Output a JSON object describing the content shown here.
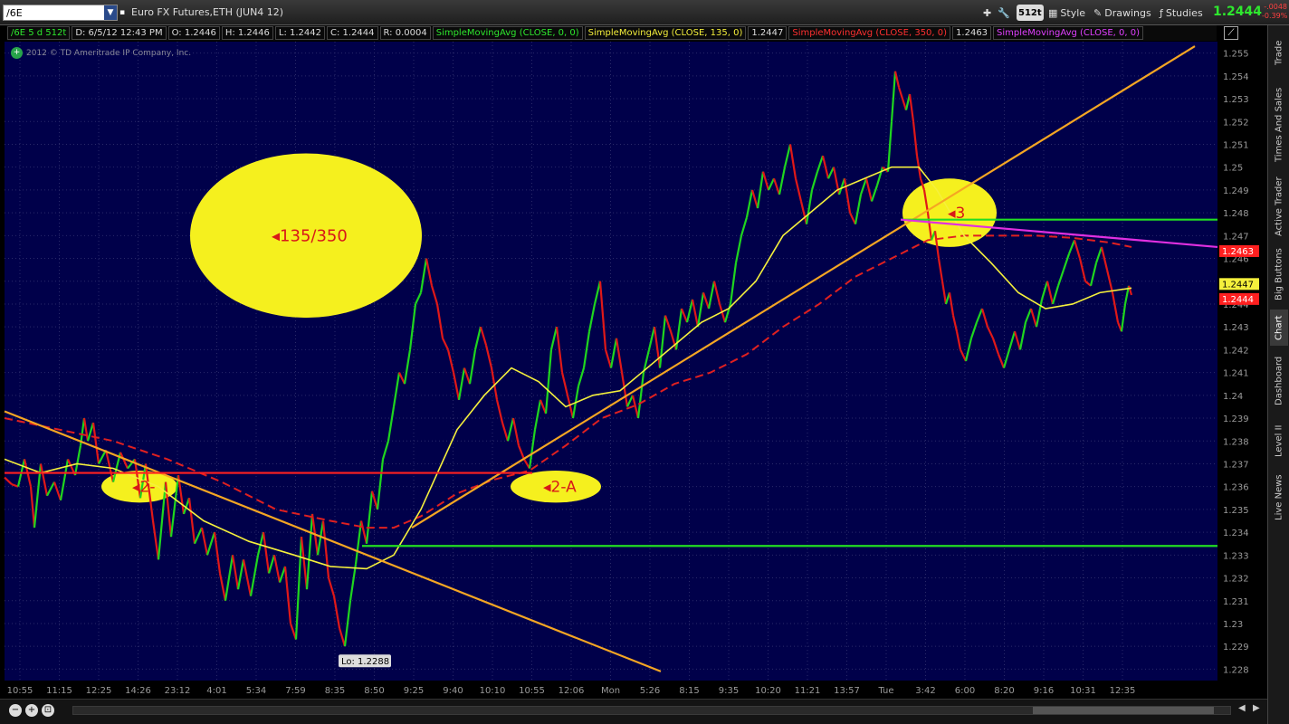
{
  "toolbar": {
    "symbol": "/6E",
    "title": "Euro FX Futures,ETH (JUN4 12)",
    "aggregation": "512t",
    "style_label": "Style",
    "drawings_label": "Drawings",
    "studies_label": "Studies",
    "last_price": "1.2444",
    "change_abs": "-.0048",
    "change_pct": "-0.39%"
  },
  "study_bar": {
    "symbol_cell": "/6E 5 d 512t",
    "date_cell": "D: 6/5/12 12:43 PM",
    "open_cell": "O: 1.2446",
    "high_cell": "H: 1.2446",
    "low_cell": "L: 1.2442",
    "close_cell": "C: 1.2444",
    "range_cell": "R: 0.0004",
    "sma1": "SimpleMovingAvg (CLOSE, 0, 0)",
    "sma2": "SimpleMovingAvg (CLOSE, 135, 0)",
    "sma2_val": "1.2447",
    "sma3": "SimpleMovingAvg (CLOSE, 350, 0)",
    "sma3_val": "1.2463",
    "sma4": "SimpleMovingAvg (CLOSE, 0, 0)"
  },
  "copyright": "2012 © TD Ameritrade IP Company, Inc.",
  "colors": {
    "background": "#00004a",
    "grid": "#2a2a6a",
    "up_bar": "#1fd61f",
    "down_bar": "#e01818",
    "sma_fast": "#f5f03c",
    "sma_slow": "#e02020",
    "trendline": "#f5a623",
    "support": "#22dd22",
    "resistance": "#ff2020",
    "channel": "#e030e0",
    "annotation_fill": "#f5f01e"
  },
  "right_tabs": [
    "Trade",
    "Times And Sales",
    "Active Trader",
    "Big Buttons",
    "Chart",
    "Dashboard",
    "Level II",
    "Live News"
  ],
  "chart_data": {
    "type": "line",
    "title": "",
    "xlabel": "",
    "ylabel": "",
    "ylim": [
      1.2275,
      1.2555
    ],
    "grid": true,
    "y_ticks": [
      "1.255",
      "1.254",
      "1.253",
      "1.252",
      "1.251",
      "1.25",
      "1.249",
      "1.248",
      "1.247",
      "1.246",
      "1.245",
      "1.244",
      "1.243",
      "1.242",
      "1.241",
      "1.24",
      "1.239",
      "1.238",
      "1.237",
      "1.236",
      "1.235",
      "1.234",
      "1.233",
      "1.232",
      "1.231",
      "1.23",
      "1.229",
      "1.228"
    ],
    "x_ticks": [
      "10:55",
      "11:15",
      "12:25",
      "14:26",
      "23:12",
      "4:01",
      "5:34",
      "7:59",
      "8:35",
      "8:50",
      "9:25",
      "9:40",
      "10:10",
      "10:55",
      "12:06",
      "Mon",
      "5:26",
      "8:15",
      "9:35",
      "10:20",
      "11:21",
      "13:57",
      "Tue",
      "3:42",
      "6:00",
      "8:20",
      "9:16",
      "10:31",
      "12:35"
    ],
    "price_series": [
      [
        0,
        1.2364
      ],
      [
        8,
        1.2361
      ],
      [
        15,
        1.236
      ],
      [
        22,
        1.2372
      ],
      [
        29,
        1.236
      ],
      [
        33,
        1.2342
      ],
      [
        40,
        1.237
      ],
      [
        47,
        1.2356
      ],
      [
        55,
        1.2362
      ],
      [
        62,
        1.2354
      ],
      [
        70,
        1.2372
      ],
      [
        78,
        1.2365
      ],
      [
        84,
        1.2378
      ],
      [
        88,
        1.239
      ],
      [
        92,
        1.238
      ],
      [
        98,
        1.2388
      ],
      [
        104,
        1.237
      ],
      [
        112,
        1.2376
      ],
      [
        120,
        1.2362
      ],
      [
        128,
        1.2375
      ],
      [
        136,
        1.2368
      ],
      [
        144,
        1.2372
      ],
      [
        150,
        1.2355
      ],
      [
        156,
        1.237
      ],
      [
        164,
        1.2345
      ],
      [
        170,
        1.2328
      ],
      [
        178,
        1.2362
      ],
      [
        184,
        1.2338
      ],
      [
        192,
        1.2365
      ],
      [
        198,
        1.2348
      ],
      [
        204,
        1.2355
      ],
      [
        210,
        1.2335
      ],
      [
        218,
        1.2342
      ],
      [
        224,
        1.233
      ],
      [
        232,
        1.234
      ],
      [
        238,
        1.2322
      ],
      [
        244,
        1.231
      ],
      [
        252,
        1.233
      ],
      [
        258,
        1.2315
      ],
      [
        264,
        1.2328
      ],
      [
        272,
        1.2312
      ],
      [
        280,
        1.233
      ],
      [
        286,
        1.234
      ],
      [
        292,
        1.2322
      ],
      [
        298,
        1.233
      ],
      [
        304,
        1.2318
      ],
      [
        310,
        1.2325
      ],
      [
        316,
        1.23
      ],
      [
        322,
        1.2293
      ],
      [
        328,
        1.2338
      ],
      [
        334,
        1.2315
      ],
      [
        340,
        1.2348
      ],
      [
        346,
        1.233
      ],
      [
        352,
        1.2345
      ],
      [
        358,
        1.232
      ],
      [
        364,
        1.2312
      ],
      [
        370,
        1.2298
      ],
      [
        376,
        1.229
      ],
      [
        382,
        1.231
      ],
      [
        388,
        1.2326
      ],
      [
        394,
        1.2345
      ],
      [
        400,
        1.2335
      ],
      [
        406,
        1.2358
      ],
      [
        412,
        1.235
      ],
      [
        418,
        1.2372
      ],
      [
        424,
        1.238
      ],
      [
        430,
        1.2395
      ],
      [
        436,
        1.241
      ],
      [
        442,
        1.2405
      ],
      [
        448,
        1.242
      ],
      [
        454,
        1.244
      ],
      [
        460,
        1.2445
      ],
      [
        466,
        1.246
      ],
      [
        472,
        1.2448
      ],
      [
        478,
        1.244
      ],
      [
        484,
        1.2425
      ],
      [
        490,
        1.242
      ],
      [
        496,
        1.241
      ],
      [
        502,
        1.2398
      ],
      [
        508,
        1.2412
      ],
      [
        514,
        1.2405
      ],
      [
        520,
        1.242
      ],
      [
        526,
        1.243
      ],
      [
        532,
        1.2422
      ],
      [
        538,
        1.2412
      ],
      [
        544,
        1.2398
      ],
      [
        550,
        1.2388
      ],
      [
        556,
        1.238
      ],
      [
        562,
        1.239
      ],
      [
        568,
        1.2378
      ],
      [
        574,
        1.2372
      ],
      [
        580,
        1.2368
      ],
      [
        586,
        1.2385
      ],
      [
        592,
        1.2398
      ],
      [
        598,
        1.2392
      ],
      [
        604,
        1.242
      ],
      [
        610,
        1.243
      ],
      [
        616,
        1.241
      ],
      [
        622,
        1.24
      ],
      [
        628,
        1.239
      ],
      [
        634,
        1.2404
      ],
      [
        640,
        1.2412
      ],
      [
        646,
        1.2428
      ],
      [
        652,
        1.244
      ],
      [
        658,
        1.245
      ],
      [
        664,
        1.242
      ],
      [
        670,
        1.2412
      ],
      [
        676,
        1.2425
      ],
      [
        682,
        1.241
      ],
      [
        688,
        1.2395
      ],
      [
        694,
        1.24
      ],
      [
        700,
        1.239
      ],
      [
        706,
        1.241
      ],
      [
        712,
        1.242
      ],
      [
        718,
        1.243
      ],
      [
        724,
        1.2412
      ],
      [
        730,
        1.2435
      ],
      [
        736,
        1.2428
      ],
      [
        742,
        1.242
      ],
      [
        748,
        1.2438
      ],
      [
        754,
        1.2432
      ],
      [
        760,
        1.2442
      ],
      [
        766,
        1.243
      ],
      [
        772,
        1.2445
      ],
      [
        778,
        1.2438
      ],
      [
        784,
        1.245
      ],
      [
        790,
        1.244
      ],
      [
        796,
        1.2432
      ],
      [
        802,
        1.244
      ],
      [
        808,
        1.2458
      ],
      [
        814,
        1.247
      ],
      [
        820,
        1.2478
      ],
      [
        826,
        1.249
      ],
      [
        832,
        1.2482
      ],
      [
        838,
        1.2498
      ],
      [
        844,
        1.249
      ],
      [
        850,
        1.2495
      ],
      [
        856,
        1.2488
      ],
      [
        862,
        1.25
      ],
      [
        868,
        1.251
      ],
      [
        874,
        1.2495
      ],
      [
        880,
        1.2485
      ],
      [
        886,
        1.2475
      ],
      [
        892,
        1.249
      ],
      [
        898,
        1.2498
      ],
      [
        904,
        1.2505
      ],
      [
        910,
        1.2495
      ],
      [
        916,
        1.25
      ],
      [
        922,
        1.2488
      ],
      [
        928,
        1.2495
      ],
      [
        934,
        1.248
      ],
      [
        940,
        1.2475
      ],
      [
        946,
        1.2488
      ],
      [
        952,
        1.2495
      ],
      [
        958,
        1.2485
      ],
      [
        964,
        1.2492
      ],
      [
        970,
        1.25
      ],
      [
        976,
        1.2498
      ],
      [
        980,
        1.252
      ],
      [
        984,
        1.2542
      ],
      [
        988,
        1.2535
      ],
      [
        992,
        1.253
      ],
      [
        996,
        1.2525
      ],
      [
        1000,
        1.2532
      ],
      [
        1004,
        1.252
      ],
      [
        1008,
        1.2505
      ],
      [
        1012,
        1.2495
      ],
      [
        1016,
        1.249
      ],
      [
        1020,
        1.248
      ],
      [
        1024,
        1.2468
      ],
      [
        1028,
        1.2472
      ],
      [
        1032,
        1.246
      ],
      [
        1036,
        1.245
      ],
      [
        1040,
        1.244
      ],
      [
        1044,
        1.2445
      ],
      [
        1048,
        1.2435
      ],
      [
        1052,
        1.2428
      ],
      [
        1056,
        1.242
      ],
      [
        1062,
        1.2415
      ],
      [
        1068,
        1.2425
      ],
      [
        1074,
        1.2432
      ],
      [
        1080,
        1.2438
      ],
      [
        1086,
        1.243
      ],
      [
        1092,
        1.2425
      ],
      [
        1098,
        1.2418
      ],
      [
        1104,
        1.2412
      ],
      [
        1110,
        1.242
      ],
      [
        1116,
        1.2428
      ],
      [
        1122,
        1.242
      ],
      [
        1128,
        1.2432
      ],
      [
        1134,
        1.2438
      ],
      [
        1140,
        1.243
      ],
      [
        1146,
        1.2442
      ],
      [
        1152,
        1.245
      ],
      [
        1158,
        1.244
      ],
      [
        1164,
        1.2448
      ],
      [
        1170,
        1.2455
      ],
      [
        1176,
        1.2462
      ],
      [
        1182,
        1.2468
      ],
      [
        1188,
        1.246
      ],
      [
        1194,
        1.245
      ],
      [
        1200,
        1.2448
      ],
      [
        1206,
        1.2458
      ],
      [
        1212,
        1.2465
      ],
      [
        1218,
        1.2455
      ],
      [
        1224,
        1.2445
      ],
      [
        1230,
        1.2432
      ],
      [
        1234,
        1.2428
      ],
      [
        1238,
        1.244
      ],
      [
        1242,
        1.2448
      ],
      [
        1245,
        1.2444
      ]
    ],
    "sma_fast_series": [
      [
        0,
        1.2372
      ],
      [
        40,
        1.2366
      ],
      [
        80,
        1.237
      ],
      [
        120,
        1.2368
      ],
      [
        170,
        1.236
      ],
      [
        220,
        1.2345
      ],
      [
        270,
        1.2336
      ],
      [
        320,
        1.233
      ],
      [
        360,
        1.2325
      ],
      [
        400,
        1.2324
      ],
      [
        430,
        1.233
      ],
      [
        460,
        1.235
      ],
      [
        500,
        1.2385
      ],
      [
        530,
        1.24
      ],
      [
        560,
        1.2412
      ],
      [
        590,
        1.2406
      ],
      [
        620,
        1.2395
      ],
      [
        650,
        1.24
      ],
      [
        680,
        1.2402
      ],
      [
        710,
        1.2412
      ],
      [
        740,
        1.2422
      ],
      [
        770,
        1.2432
      ],
      [
        800,
        1.2438
      ],
      [
        830,
        1.245
      ],
      [
        860,
        1.247
      ],
      [
        890,
        1.248
      ],
      [
        920,
        1.249
      ],
      [
        950,
        1.2495
      ],
      [
        980,
        1.25
      ],
      [
        1010,
        1.25
      ],
      [
        1030,
        1.249
      ],
      [
        1060,
        1.247
      ],
      [
        1090,
        1.2458
      ],
      [
        1120,
        1.2445
      ],
      [
        1150,
        1.2438
      ],
      [
        1180,
        1.244
      ],
      [
        1210,
        1.2445
      ],
      [
        1245,
        1.2447
      ]
    ],
    "sma_slow_series": [
      [
        0,
        1.239
      ],
      [
        60,
        1.2385
      ],
      [
        120,
        1.238
      ],
      [
        180,
        1.2372
      ],
      [
        240,
        1.2362
      ],
      [
        300,
        1.235
      ],
      [
        360,
        1.2345
      ],
      [
        400,
        1.2342
      ],
      [
        430,
        1.2342
      ],
      [
        460,
        1.2347
      ],
      [
        500,
        1.2357
      ],
      [
        540,
        1.2363
      ],
      [
        580,
        1.2367
      ],
      [
        620,
        1.2378
      ],
      [
        660,
        1.239
      ],
      [
        700,
        1.2396
      ],
      [
        740,
        1.2405
      ],
      [
        780,
        1.241
      ],
      [
        820,
        1.2418
      ],
      [
        860,
        1.243
      ],
      [
        900,
        1.244
      ],
      [
        940,
        1.2452
      ],
      [
        980,
        1.246
      ],
      [
        1020,
        1.2468
      ],
      [
        1060,
        1.247
      ],
      [
        1100,
        1.247
      ],
      [
        1140,
        1.247
      ],
      [
        1180,
        1.2469
      ],
      [
        1220,
        1.2467
      ],
      [
        1245,
        1.2465
      ]
    ],
    "price_labels": [
      {
        "label": "1.2463",
        "value": 1.2463,
        "color": "#ff2020"
      },
      {
        "label": "1.2447",
        "value": 1.2447,
        "color": "#f5f03c"
      },
      {
        "label": "1.2444",
        "value": 1.2444,
        "color": "#ff2020"
      }
    ],
    "low_label": "Lo: 1.2288",
    "annotations": [
      {
        "label": "135/350",
        "cx": 338,
        "cy": 1.247,
        "rx": 128,
        "ry": 0.0036
      },
      {
        "label": "2-",
        "cx": 154,
        "cy": 1.236,
        "rx": 42,
        "ry": 0.0007
      },
      {
        "label": "2-A",
        "cx": 614,
        "cy": 1.236,
        "rx": 50,
        "ry": 0.0007
      },
      {
        "label": "3",
        "cx": 1049,
        "cy": 1.248,
        "rx": 52,
        "ry": 0.0015
      }
    ],
    "trendlines": [
      {
        "kind": "trendline",
        "x1": 5,
        "y1": 1.2393,
        "x2": 730,
        "y2": 1.2279
      },
      {
        "kind": "trendline",
        "x1": 455,
        "y1": 1.2342,
        "x2": 1320,
        "y2": 1.2553
      },
      {
        "kind": "resistance",
        "x1": 5,
        "y1": 1.2366,
        "x2": 588,
        "y2": 1.2366
      },
      {
        "kind": "support",
        "x1": 400,
        "y1": 1.2334,
        "x2": 1345,
        "y2": 1.2334
      },
      {
        "kind": "support",
        "x1": 995,
        "y1": 1.2477,
        "x2": 1345,
        "y2": 1.2477
      },
      {
        "kind": "channel",
        "x1": 995,
        "y1": 1.2477,
        "x2": 1345,
        "y2": 1.2465
      }
    ]
  }
}
